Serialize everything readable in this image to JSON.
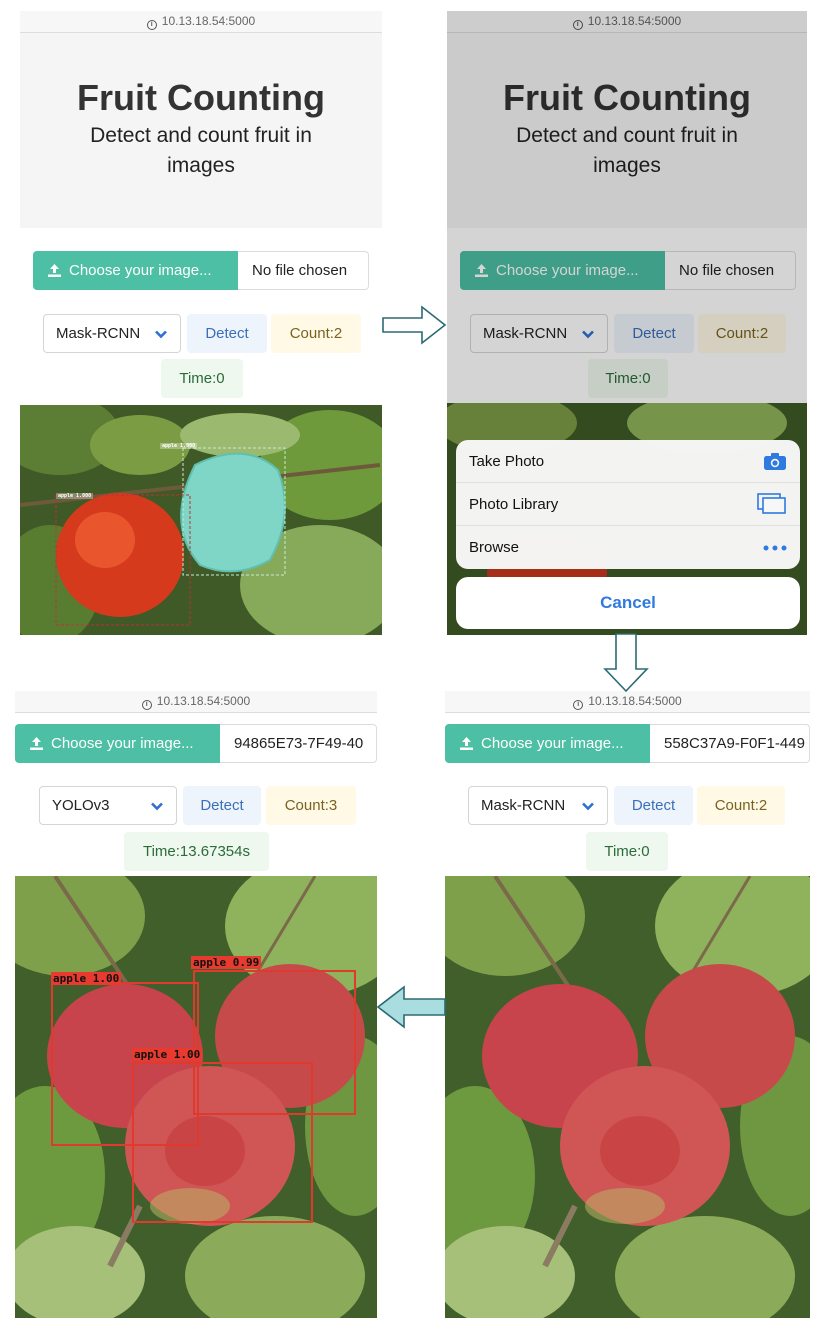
{
  "url": "10.13.18.54:5000",
  "app": {
    "title": "Fruit Counting",
    "subtitle": "Detect and count fruit in images"
  },
  "upload": {
    "button_label": "Choose your image...",
    "panel1_file": "No file chosen",
    "panel2_file": "No file chosen",
    "panel3_file": "94865E73-7F49-40",
    "panel4_file": "558C37A9-F0F1-449"
  },
  "controls": {
    "detect_label": "Detect",
    "panel1": {
      "model": "Mask-RCNN",
      "count": "Count:2",
      "time": "Time:0"
    },
    "panel2": {
      "model": "Mask-RCNN",
      "count": "Count:2",
      "time": "Time:0"
    },
    "panel3": {
      "model": "YOLOv3",
      "count": "Count:3",
      "time": "Time:13.67354s"
    },
    "panel4": {
      "model": "Mask-RCNN",
      "count": "Count:2",
      "time": "Time:0"
    }
  },
  "action_sheet": {
    "items": [
      {
        "label": "Take Photo",
        "icon": "camera-icon"
      },
      {
        "label": "Photo Library",
        "icon": "photo-library-icon"
      },
      {
        "label": "Browse",
        "icon": "more-icon"
      }
    ],
    "cancel_label": "Cancel"
  },
  "detections": {
    "panel1": [
      "apple 1.000",
      "apple 1.000"
    ],
    "panel3": [
      "apple 1.00",
      "apple 0.99",
      "apple 1.00"
    ]
  },
  "colors": {
    "accent": "#4cbfa4",
    "detect_bg": "#eef4fc",
    "count_bg": "#fff9e6",
    "time_bg": "#eef8ef",
    "ios_blue": "#2f7ae0",
    "box_red": "#e03a2e",
    "arrow": "#a9dde0"
  }
}
